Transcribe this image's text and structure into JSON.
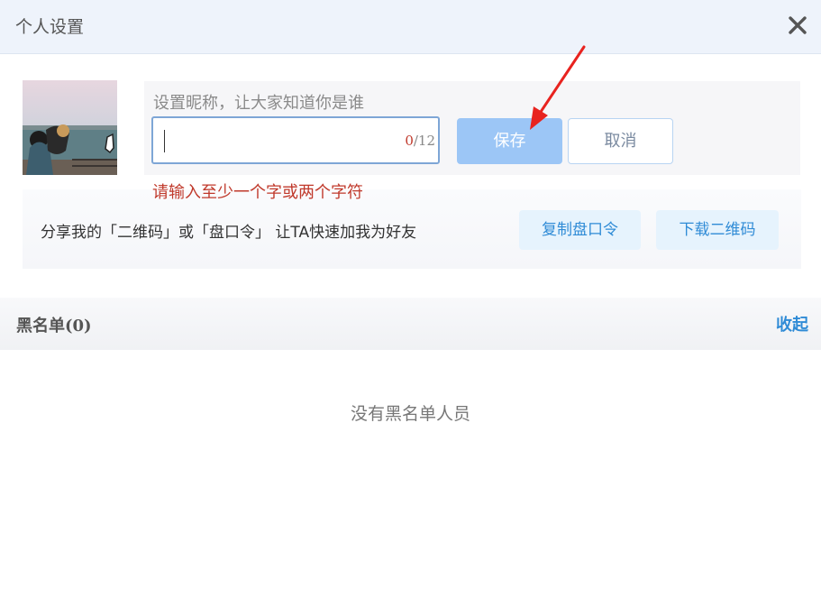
{
  "window": {
    "title": "个人设置",
    "close_icon": "close-icon"
  },
  "profile": {
    "avatar_icon": "avatar-photo",
    "nickname_prompt": "设置昵称，让大家知道你是谁",
    "nickname_value": "",
    "counter_current": "0",
    "counter_separator": "/12",
    "save_label": "保存",
    "cancel_label": "取消",
    "error_text": "请输入至少一个字或两个字符"
  },
  "share": {
    "text": "分享我的「二维码」或「盘口令」 让TA快速加我为好友",
    "copy_label": "复制盘口令",
    "download_label": "下载二维码"
  },
  "blacklist": {
    "title": "黑名单(0)",
    "collapse_label": "收起",
    "empty_text": "没有黑名单人员"
  },
  "colors": {
    "accent": "#2f8bd6",
    "save_button": "#9cc6f6",
    "error": "#c0392b",
    "annotation_arrow": "#e8231f"
  }
}
